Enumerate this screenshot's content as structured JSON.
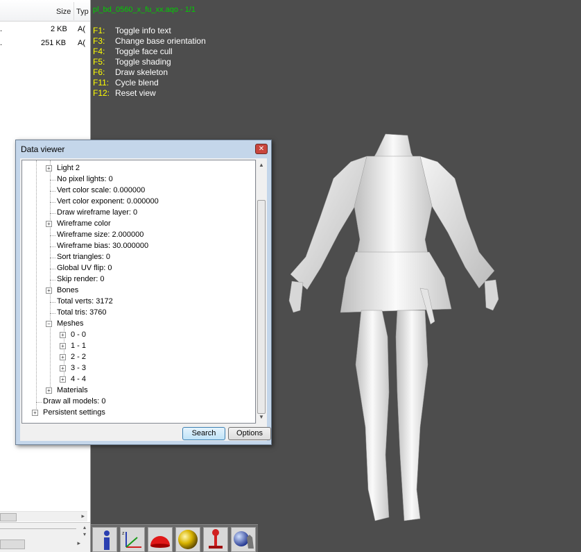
{
  "explorer": {
    "columns": {
      "size": "Size",
      "type": "Typ"
    },
    "files": [
      {
        "name_fragment": ".",
        "size": "2 KB",
        "type_fragment": "A("
      },
      {
        "name_fragment": ".",
        "size": "251 KB",
        "type_fragment": "A("
      }
    ]
  },
  "viewport": {
    "title": "pl_bd_0560_x_fu_xx.aqo - 1/1",
    "title_color": "#00d000",
    "key_color": "#ffff00",
    "background": "#4d4d4d",
    "help": [
      {
        "key": "F1:",
        "desc": "Toggle info text"
      },
      {
        "key": "F3:",
        "desc": "Change base orientation"
      },
      {
        "key": "F4:",
        "desc": "Toggle face cull"
      },
      {
        "key": "F5:",
        "desc": "Toggle shading"
      },
      {
        "key": "F6:",
        "desc": "Draw skeleton"
      },
      {
        "key": "F11:",
        "desc": "Cycle blend"
      },
      {
        "key": "F12:",
        "desc": "Reset view"
      }
    ],
    "toolbar_icons": [
      "info-icon",
      "axes-icon",
      "dome-icon",
      "sphere-icon",
      "bone-icon",
      "hand-sphere-icon"
    ]
  },
  "data_viewer": {
    "title": "Data viewer",
    "close_glyph": "✕",
    "tree": [
      {
        "label": "Light 2",
        "expandable": true
      },
      {
        "label": "No pixel lights: 0",
        "expandable": false
      },
      {
        "label": "Vert color scale: 0.000000",
        "expandable": false
      },
      {
        "label": "Vert color exponent: 0.000000",
        "expandable": false
      },
      {
        "label": "Draw wireframe layer: 0",
        "expandable": false
      },
      {
        "label": "Wireframe color",
        "expandable": true
      },
      {
        "label": "Wireframe size: 2.000000",
        "expandable": false
      },
      {
        "label": "Wireframe bias: 30.000000",
        "expandable": false
      },
      {
        "label": "Sort triangles: 0",
        "expandable": false
      },
      {
        "label": "Global UV flip: 0",
        "expandable": false
      },
      {
        "label": "Skip render: 0",
        "expandable": false
      },
      {
        "label": "Bones",
        "expandable": true
      },
      {
        "label": "Total verts: 3172",
        "expandable": false
      },
      {
        "label": "Total tris: 3760",
        "expandable": false
      },
      {
        "label": "Meshes",
        "expandable": true,
        "expanded": true
      },
      {
        "label": "0 - 0",
        "expandable": true
      },
      {
        "label": "1 - 1",
        "expandable": true
      },
      {
        "label": "2 - 2",
        "expandable": true
      },
      {
        "label": "3 - 3",
        "expandable": true
      },
      {
        "label": "4 - 4",
        "expandable": true
      },
      {
        "label": "Materials",
        "expandable": true
      },
      {
        "label": "Draw all models: 0",
        "expandable": false
      },
      {
        "label": "Persistent settings",
        "expandable": true
      }
    ],
    "buttons": {
      "search": "Search",
      "options": "Options"
    }
  }
}
